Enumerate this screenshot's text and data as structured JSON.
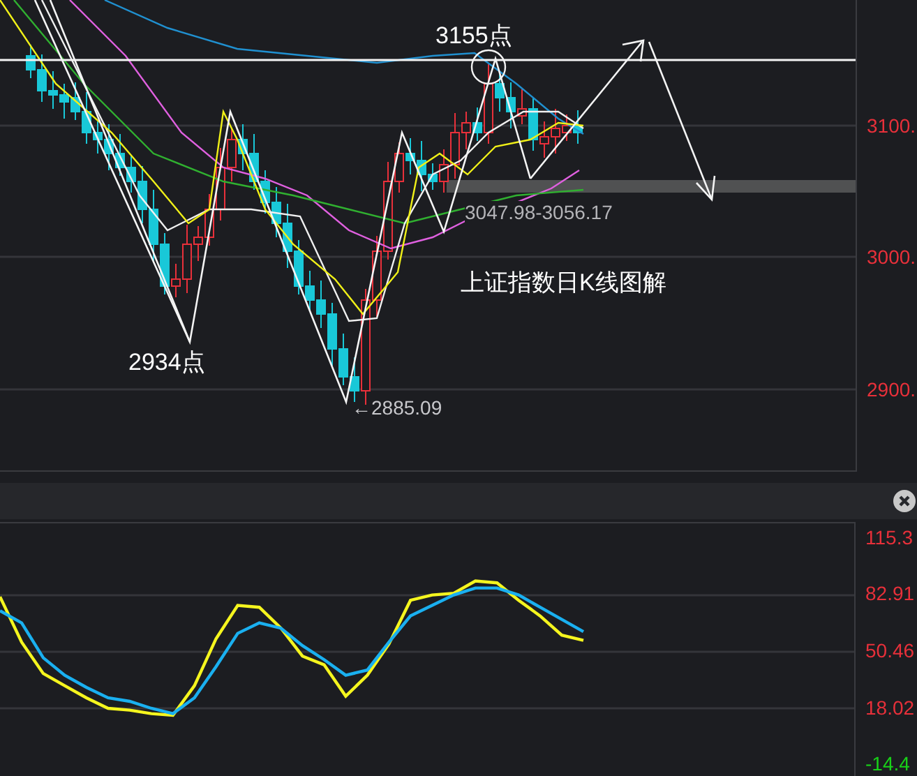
{
  "price_panel": {
    "axis_labels": [
      "3100.",
      "3000.",
      "2900."
    ],
    "annotations": [
      {
        "text": "3155点"
      },
      {
        "text": "3047.98-3056.17"
      },
      {
        "text": "上证指数日K线图解"
      },
      {
        "text": "2934点"
      },
      {
        "text": "←2885.09"
      }
    ]
  },
  "indicator_panel": {
    "chart_data": {
      "type": "line",
      "grid": true,
      "ylim": [
        -23.2,
        124.1
      ],
      "yticks": [
        {
          "value": 115.3,
          "label": "115.3"
        },
        {
          "value": 82.91,
          "label": "82.91"
        },
        {
          "value": 50.46,
          "label": "50.46"
        },
        {
          "value": 18.02,
          "label": "18.02"
        },
        {
          "value": -14.4,
          "label": "-14.4"
        }
      ],
      "series": [
        {
          "color": "#f5f51e",
          "values": [
            82,
            56,
            38,
            31,
            24,
            18,
            17,
            15,
            14,
            31,
            58,
            77,
            76,
            64,
            48,
            43,
            25,
            37,
            55,
            80,
            83,
            84,
            91,
            90,
            80,
            71,
            60,
            57
          ]
        },
        {
          "color": "#1ab0f0",
          "values": [
            74,
            67,
            47,
            37,
            30,
            24,
            22,
            18,
            15,
            24,
            42,
            61,
            67,
            64,
            54,
            46,
            37,
            40,
            56,
            71,
            77,
            83,
            87,
            87,
            83,
            76,
            69,
            62
          ]
        }
      ]
    }
  }
}
